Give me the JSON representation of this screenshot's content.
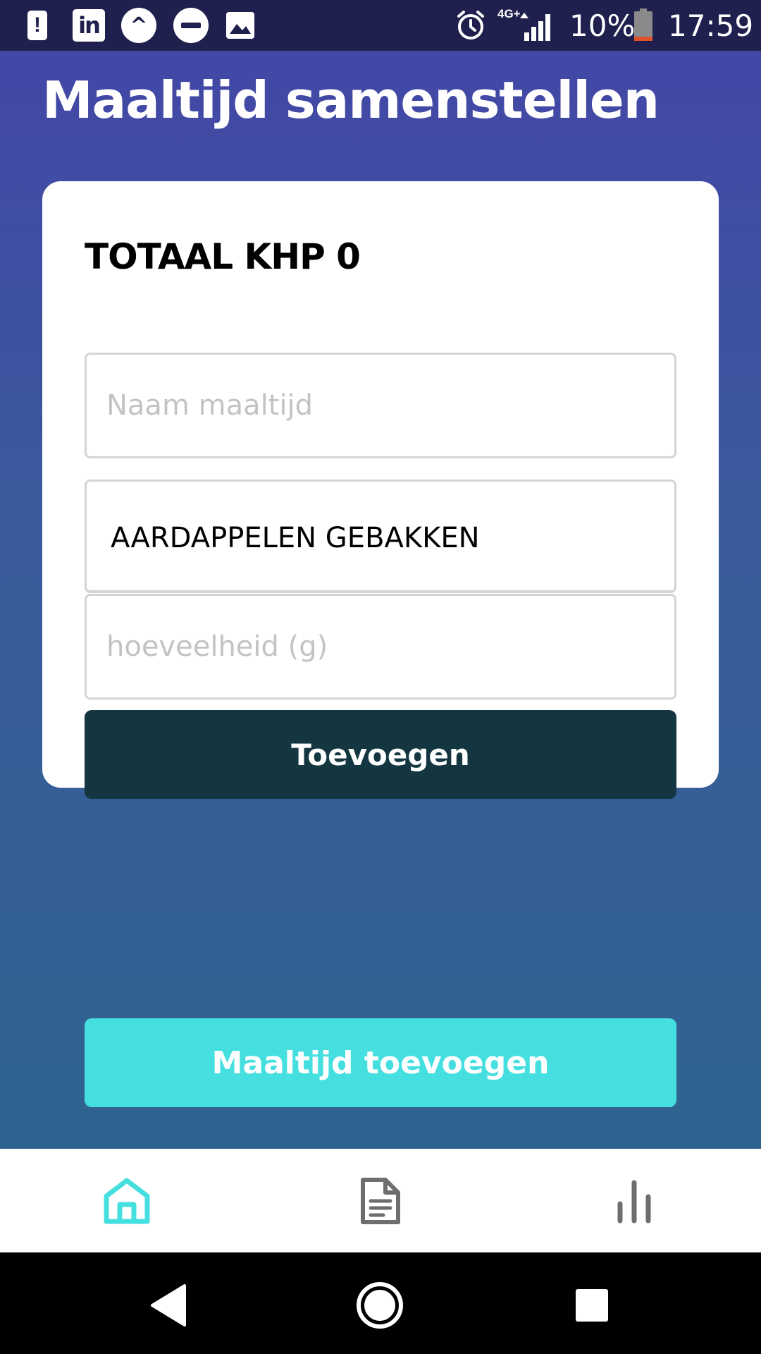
{
  "status_bar": {
    "network": "4G+",
    "battery_percent": "10%",
    "time": "17:59",
    "icons": [
      "alert-icon",
      "linkedin-icon",
      "caret-icon",
      "do-not-disturb-icon",
      "image-icon",
      "alarm-icon",
      "signal-icon",
      "battery-icon"
    ]
  },
  "page": {
    "title": "Maaltijd samenstellen"
  },
  "card": {
    "total_label": "TOTAAL KHP 0",
    "meal_name": {
      "value": "",
      "placeholder": "Naam maaltijd"
    },
    "product": {
      "value": "AARDAPPELEN GEBAKKEN"
    },
    "amount": {
      "value": "",
      "placeholder": "hoeveelheid (g)"
    },
    "add_label": "Toevoegen"
  },
  "add_meal_label": "Maaltijd toevoegen",
  "tabbar": {
    "tabs": [
      {
        "icon": "home-icon",
        "active": true
      },
      {
        "icon": "document-icon",
        "active": false
      },
      {
        "icon": "bar-chart-icon",
        "active": false
      }
    ],
    "active_color": "#46dfe0",
    "inactive_color": "#6e6e6e"
  },
  "colors": {
    "header_top": "#4347a6",
    "header_bottom": "#2f638f",
    "dark_button": "#143640",
    "accent_button": "#46dfe0"
  }
}
